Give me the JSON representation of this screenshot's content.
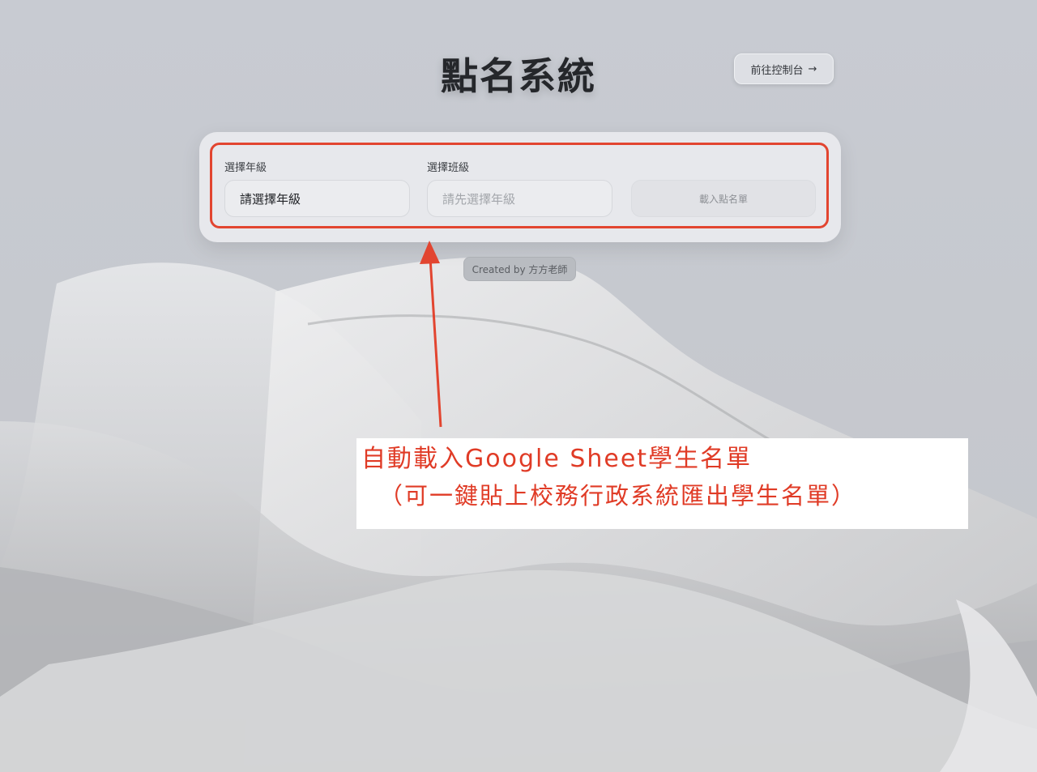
{
  "header": {
    "title": "點名系統",
    "console_button": {
      "label": "前往控制台",
      "arrow": "→"
    }
  },
  "form": {
    "grade": {
      "label": "選擇年級",
      "value": "請選擇年級"
    },
    "class": {
      "label": "選擇班級",
      "placeholder": "請先選擇年級"
    },
    "load_button": "載入點名單"
  },
  "footer": {
    "credit": "Created by 方方老師"
  },
  "annotation": {
    "line1": "自動載入Google Sheet學生名單",
    "line2": "（可一鍵貼上校務行政系統匯出學生名單）",
    "color": "#e03b26"
  },
  "colors": {
    "highlight_border": "#e24530",
    "background": "#c8cbd2",
    "panel": "#e7e8ec"
  }
}
